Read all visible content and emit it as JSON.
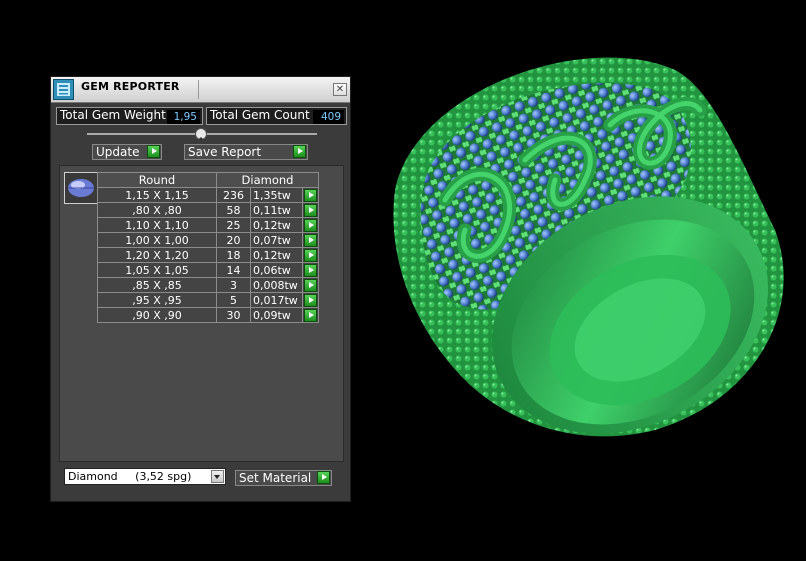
{
  "panel": {
    "title": "GEM REPORTER",
    "close_glyph": "✕",
    "icon": "gem-reporter-app-icon",
    "stats": {
      "weight_label": "Total Gem Weight",
      "weight_value": "1,95",
      "count_label": "Total Gem Count",
      "count_value": "409"
    },
    "buttons": {
      "update": "Update",
      "save_report": "Save Report",
      "set_material": "Set Material"
    },
    "table": {
      "header_shape": "Round",
      "header_material": "Diamond",
      "rows": [
        {
          "size": "1,15 X 1,15",
          "count": "236",
          "weight": "1,35tw"
        },
        {
          "size": ",80 X ,80",
          "count": "58",
          "weight": "0,11tw"
        },
        {
          "size": "1,10 X 1,10",
          "count": "25",
          "weight": "0,12tw"
        },
        {
          "size": "1,00 X 1,00",
          "count": "20",
          "weight": "0,07tw"
        },
        {
          "size": "1,20 X 1,20",
          "count": "18",
          "weight": "0,12tw"
        },
        {
          "size": "1,05 X 1,05",
          "count": "14",
          "weight": "0,06tw"
        },
        {
          "size": ",85 X ,85",
          "count": "3",
          "weight": "0,008tw"
        },
        {
          "size": ",95 X ,95",
          "count": "5",
          "weight": "0,017tw"
        },
        {
          "size": ",90 X ,90",
          "count": "30",
          "weight": "0,09tw"
        }
      ]
    },
    "material_select": {
      "value": "Diamond     (3,52 spg)"
    },
    "colors": {
      "panel_bg": "#3b3b3b",
      "value_text": "#7cc8ff",
      "green_button": "#2fb02f"
    }
  },
  "viewport": {
    "ring_color": "#2fa84f",
    "stone_color": "#4f7fd0"
  }
}
